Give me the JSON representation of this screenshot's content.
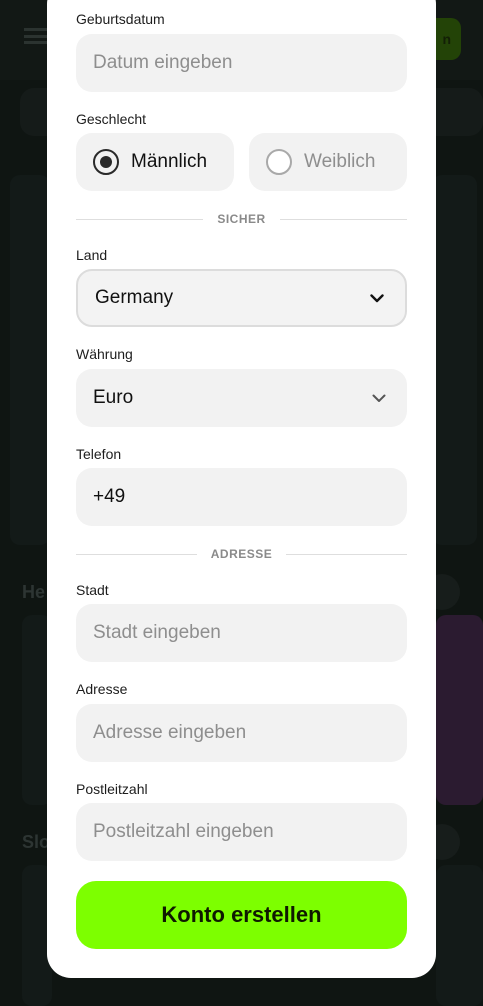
{
  "background": {
    "headings": [
      "He",
      "Slo"
    ]
  },
  "form": {
    "birthdate": {
      "label": "Geburtsdatum",
      "placeholder": "Datum eingeben"
    },
    "gender": {
      "label": "Geschlecht",
      "options": [
        {
          "label": "Männlich",
          "selected": true
        },
        {
          "label": "Weiblich",
          "selected": false
        }
      ]
    },
    "section_secure": "SICHER",
    "country": {
      "label": "Land",
      "value": "Germany",
      "icon": "chevron-down-icon"
    },
    "currency": {
      "label": "Währung",
      "value": "Euro",
      "icon": "chevron-down-icon"
    },
    "phone": {
      "label": "Telefon",
      "value": "+49"
    },
    "section_address": "ADRESSE",
    "city": {
      "label": "Stadt",
      "placeholder": "Stadt eingeben"
    },
    "address": {
      "label": "Adresse",
      "placeholder": "Adresse eingeben"
    },
    "postal": {
      "label": "Postleitzahl",
      "placeholder": "Postleitzahl eingeben"
    },
    "submit_label": "Konto erstellen"
  },
  "colors": {
    "accent": "#7dff00",
    "field_bg": "#f2f2f2",
    "backdrop": "#121816"
  }
}
